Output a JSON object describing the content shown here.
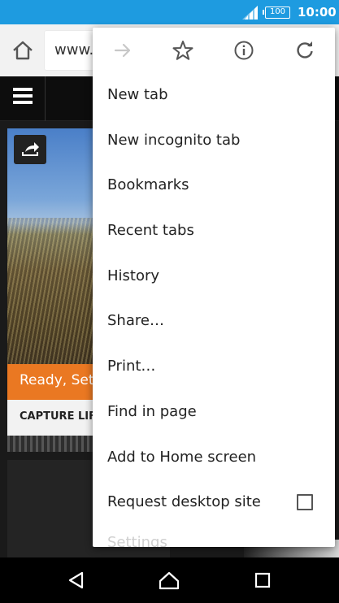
{
  "status_bar": {
    "battery": "100",
    "time": "10:00"
  },
  "toolbar": {
    "url": "www.",
    "home_icon": "home-icon"
  },
  "page": {
    "card_banner": "Ready, Set,",
    "card_label": "CAPTURE LIFE"
  },
  "menu": {
    "icons": [
      "forward-icon",
      "star-icon",
      "info-icon",
      "reload-icon"
    ],
    "items": [
      {
        "label": "New tab"
      },
      {
        "label": "New incognito tab"
      },
      {
        "label": "Bookmarks"
      },
      {
        "label": "Recent tabs"
      },
      {
        "label": "History"
      },
      {
        "label": "Share…"
      },
      {
        "label": "Print…"
      },
      {
        "label": "Find in page"
      },
      {
        "label": "Add to Home screen"
      },
      {
        "label": "Request desktop site",
        "checked": false
      },
      {
        "label": "Settings"
      }
    ]
  },
  "nav_bar": {
    "icons": [
      "back-icon",
      "home-nav-icon",
      "recents-icon"
    ]
  },
  "colors": {
    "status_bar": "#1e9be0",
    "banner_orange": "#ea7822"
  }
}
